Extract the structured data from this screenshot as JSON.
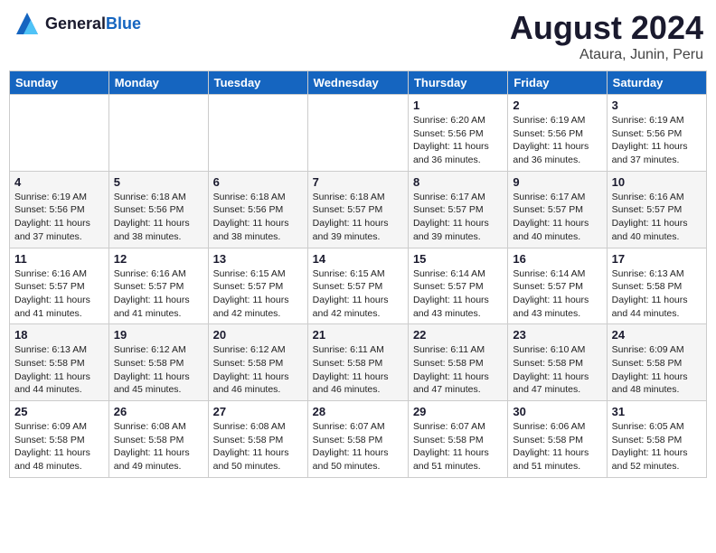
{
  "header": {
    "logo_general": "General",
    "logo_blue": "Blue",
    "month": "August 2024",
    "location": "Ataura, Junin, Peru"
  },
  "days_of_week": [
    "Sunday",
    "Monday",
    "Tuesday",
    "Wednesday",
    "Thursday",
    "Friday",
    "Saturday"
  ],
  "weeks": [
    [
      {
        "day": "",
        "info": ""
      },
      {
        "day": "",
        "info": ""
      },
      {
        "day": "",
        "info": ""
      },
      {
        "day": "",
        "info": ""
      },
      {
        "day": "1",
        "info": "Sunrise: 6:20 AM\nSunset: 5:56 PM\nDaylight: 11 hours\nand 36 minutes."
      },
      {
        "day": "2",
        "info": "Sunrise: 6:19 AM\nSunset: 5:56 PM\nDaylight: 11 hours\nand 36 minutes."
      },
      {
        "day": "3",
        "info": "Sunrise: 6:19 AM\nSunset: 5:56 PM\nDaylight: 11 hours\nand 37 minutes."
      }
    ],
    [
      {
        "day": "4",
        "info": "Sunrise: 6:19 AM\nSunset: 5:56 PM\nDaylight: 11 hours\nand 37 minutes."
      },
      {
        "day": "5",
        "info": "Sunrise: 6:18 AM\nSunset: 5:56 PM\nDaylight: 11 hours\nand 38 minutes."
      },
      {
        "day": "6",
        "info": "Sunrise: 6:18 AM\nSunset: 5:56 PM\nDaylight: 11 hours\nand 38 minutes."
      },
      {
        "day": "7",
        "info": "Sunrise: 6:18 AM\nSunset: 5:57 PM\nDaylight: 11 hours\nand 39 minutes."
      },
      {
        "day": "8",
        "info": "Sunrise: 6:17 AM\nSunset: 5:57 PM\nDaylight: 11 hours\nand 39 minutes."
      },
      {
        "day": "9",
        "info": "Sunrise: 6:17 AM\nSunset: 5:57 PM\nDaylight: 11 hours\nand 40 minutes."
      },
      {
        "day": "10",
        "info": "Sunrise: 6:16 AM\nSunset: 5:57 PM\nDaylight: 11 hours\nand 40 minutes."
      }
    ],
    [
      {
        "day": "11",
        "info": "Sunrise: 6:16 AM\nSunset: 5:57 PM\nDaylight: 11 hours\nand 41 minutes."
      },
      {
        "day": "12",
        "info": "Sunrise: 6:16 AM\nSunset: 5:57 PM\nDaylight: 11 hours\nand 41 minutes."
      },
      {
        "day": "13",
        "info": "Sunrise: 6:15 AM\nSunset: 5:57 PM\nDaylight: 11 hours\nand 42 minutes."
      },
      {
        "day": "14",
        "info": "Sunrise: 6:15 AM\nSunset: 5:57 PM\nDaylight: 11 hours\nand 42 minutes."
      },
      {
        "day": "15",
        "info": "Sunrise: 6:14 AM\nSunset: 5:57 PM\nDaylight: 11 hours\nand 43 minutes."
      },
      {
        "day": "16",
        "info": "Sunrise: 6:14 AM\nSunset: 5:57 PM\nDaylight: 11 hours\nand 43 minutes."
      },
      {
        "day": "17",
        "info": "Sunrise: 6:13 AM\nSunset: 5:58 PM\nDaylight: 11 hours\nand 44 minutes."
      }
    ],
    [
      {
        "day": "18",
        "info": "Sunrise: 6:13 AM\nSunset: 5:58 PM\nDaylight: 11 hours\nand 44 minutes."
      },
      {
        "day": "19",
        "info": "Sunrise: 6:12 AM\nSunset: 5:58 PM\nDaylight: 11 hours\nand 45 minutes."
      },
      {
        "day": "20",
        "info": "Sunrise: 6:12 AM\nSunset: 5:58 PM\nDaylight: 11 hours\nand 46 minutes."
      },
      {
        "day": "21",
        "info": "Sunrise: 6:11 AM\nSunset: 5:58 PM\nDaylight: 11 hours\nand 46 minutes."
      },
      {
        "day": "22",
        "info": "Sunrise: 6:11 AM\nSunset: 5:58 PM\nDaylight: 11 hours\nand 47 minutes."
      },
      {
        "day": "23",
        "info": "Sunrise: 6:10 AM\nSunset: 5:58 PM\nDaylight: 11 hours\nand 47 minutes."
      },
      {
        "day": "24",
        "info": "Sunrise: 6:09 AM\nSunset: 5:58 PM\nDaylight: 11 hours\nand 48 minutes."
      }
    ],
    [
      {
        "day": "25",
        "info": "Sunrise: 6:09 AM\nSunset: 5:58 PM\nDaylight: 11 hours\nand 48 minutes."
      },
      {
        "day": "26",
        "info": "Sunrise: 6:08 AM\nSunset: 5:58 PM\nDaylight: 11 hours\nand 49 minutes."
      },
      {
        "day": "27",
        "info": "Sunrise: 6:08 AM\nSunset: 5:58 PM\nDaylight: 11 hours\nand 50 minutes."
      },
      {
        "day": "28",
        "info": "Sunrise: 6:07 AM\nSunset: 5:58 PM\nDaylight: 11 hours\nand 50 minutes."
      },
      {
        "day": "29",
        "info": "Sunrise: 6:07 AM\nSunset: 5:58 PM\nDaylight: 11 hours\nand 51 minutes."
      },
      {
        "day": "30",
        "info": "Sunrise: 6:06 AM\nSunset: 5:58 PM\nDaylight: 11 hours\nand 51 minutes."
      },
      {
        "day": "31",
        "info": "Sunrise: 6:05 AM\nSunset: 5:58 PM\nDaylight: 11 hours\nand 52 minutes."
      }
    ]
  ]
}
